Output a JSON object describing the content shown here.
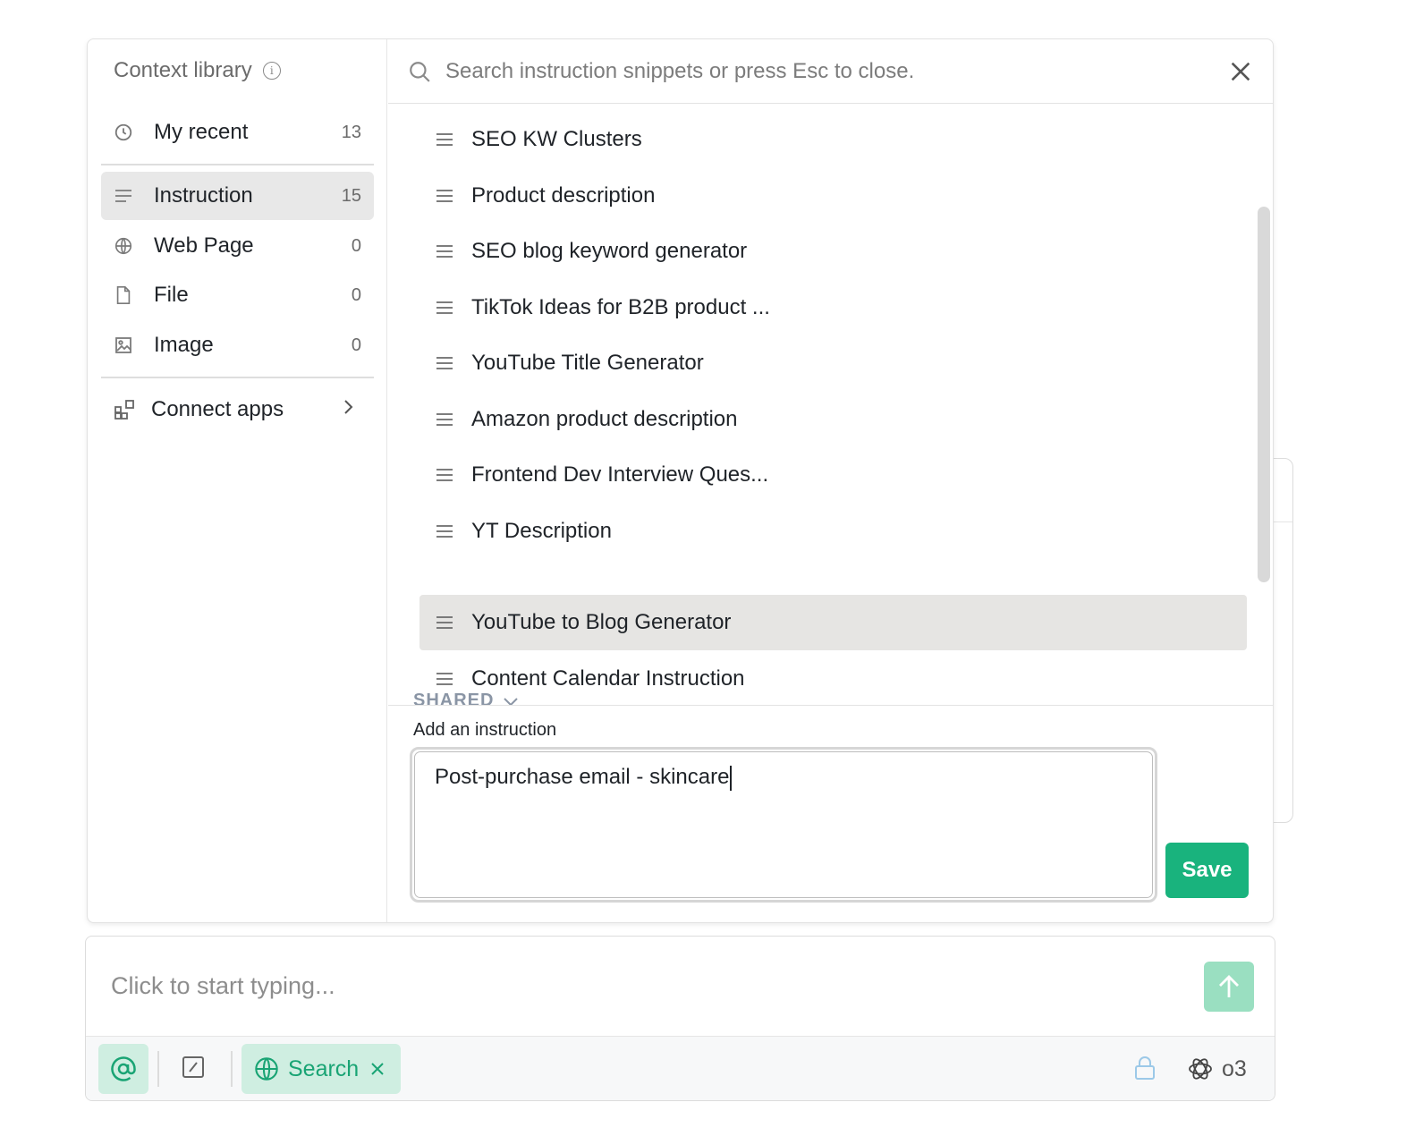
{
  "sidebar": {
    "title": "Context library",
    "items": [
      {
        "label": "My recent",
        "count": "13",
        "icon": "clock-icon"
      },
      {
        "label": "Instruction",
        "count": "15",
        "icon": "lines-icon"
      },
      {
        "label": "Web Page",
        "count": "0",
        "icon": "globe-icon"
      },
      {
        "label": "File",
        "count": "0",
        "icon": "file-icon"
      },
      {
        "label": "Image",
        "count": "0",
        "icon": "image-icon"
      }
    ],
    "active_item": "Instruction",
    "connect_label": "Connect apps"
  },
  "search": {
    "placeholder": "Search instruction snippets or press Esc to close."
  },
  "instructions": [
    "SEO KW Clusters",
    "Product description",
    "SEO blog keyword generator",
    "TikTok Ideas for B2B product ...",
    "YouTube Title Generator",
    "Amazon product description",
    "Frontend Dev Interview Ques...",
    "YT Description",
    "YouTube to Blog Generator",
    "Content Calendar Instruction"
  ],
  "highlighted_instruction": "YouTube to Blog Generator",
  "shared_label": "SHARED",
  "add_instruction": {
    "label": "Add an instruction",
    "value": "Post-purchase email - skincare",
    "save_label": "Save"
  },
  "composer": {
    "placeholder": "Click to start typing...",
    "search_chip_label": "Search",
    "model_label": "o3"
  },
  "colors": {
    "accent": "#19b37d",
    "accent_light": "#cfeee1"
  }
}
